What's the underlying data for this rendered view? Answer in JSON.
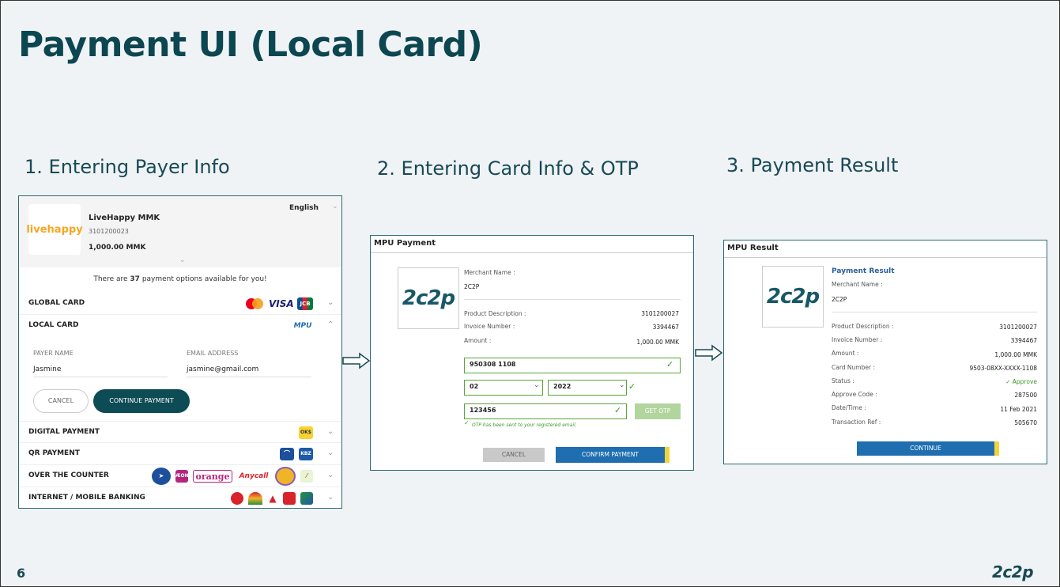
{
  "slide": {
    "title": "Payment UI (Local Card)",
    "steps": [
      "1. Entering Payer Info",
      "2. Entering Card Info & OTP",
      "3. Payment Result"
    ],
    "page_number": "6",
    "footer_brand": "2c2p"
  },
  "panel1": {
    "language": "English",
    "merchant": {
      "logo_text": "livehappy",
      "name": "LiveHappy MMK",
      "id": "3101200023",
      "amount": "1,000.00 MMK"
    },
    "options_prefix": "There are ",
    "options_count": "37",
    "options_suffix": " payment options available for you!",
    "rows": {
      "global_card": "GLOBAL CARD",
      "local_card": "LOCAL CARD",
      "digital_payment": "DIGITAL PAYMENT",
      "qr_payment": "QR PAYMENT",
      "over_the_counter": "OVER THE COUNTER",
      "internet_banking": "INTERNET / MOBILE BANKING"
    },
    "icons": {
      "visa": "VISA",
      "jcb": "JCB",
      "mpu": "MPU",
      "ok": "OK$",
      "kbz": "KBZ",
      "aeon": "ÆON",
      "orange": "orange",
      "anycall": "Anycall"
    },
    "form": {
      "payer_name_label": "PAYER NAME",
      "payer_name_value": "Jasmine",
      "email_label": "EMAIL ADDRESS",
      "email_value": "jasmine@gmail.com",
      "cancel": "CANCEL",
      "continue": "CONTINUE PAYMENT"
    }
  },
  "panel2": {
    "header": "MPU Payment",
    "logo": "2c2p",
    "merchant_name_label": "Merchant Name :",
    "merchant_name": "2C2P",
    "product_desc_label": "Product Description :",
    "product_desc": "3101200027",
    "invoice_label": "Invoice Number :",
    "invoice": "3394467",
    "amount_label": "Amount :",
    "amount": "1,000.00 MMK",
    "card_number": "950308          1108",
    "month": "02",
    "year": "2022",
    "otp": "123456",
    "get_otp": "GET OTP",
    "otp_message": "OTP has been sent to your registered email.",
    "cancel": "CANCEL",
    "confirm": "CONFIRM PAYMENT"
  },
  "panel3": {
    "header": "MPU Result",
    "logo": "2c2p",
    "result_title": "Payment Result",
    "merchant_name_label": "Merchant Name :",
    "merchant_name": "2C2P",
    "fields": [
      {
        "label": "Product Description :",
        "value": "3101200027"
      },
      {
        "label": "Invoice Number :",
        "value": "3394467"
      },
      {
        "label": "Amount :",
        "value": "1,000.00 MMK"
      },
      {
        "label": "Card Number :",
        "value": "9503-08XX-XXXX-1108"
      },
      {
        "label": "Status :",
        "value": "Approve"
      },
      {
        "label": "Approve Code :",
        "value": "287500"
      },
      {
        "label": "Date/Time :",
        "value": "11 Feb 2021"
      },
      {
        "label": "Transaction Ref :",
        "value": "505670"
      }
    ],
    "continue": "CONTINUE"
  },
  "colors": {
    "brand": "#0c4650",
    "mpu_blue": "#1e6eb0",
    "accent_yellow": "#f6d23a",
    "success_green": "#3a9b2a"
  }
}
